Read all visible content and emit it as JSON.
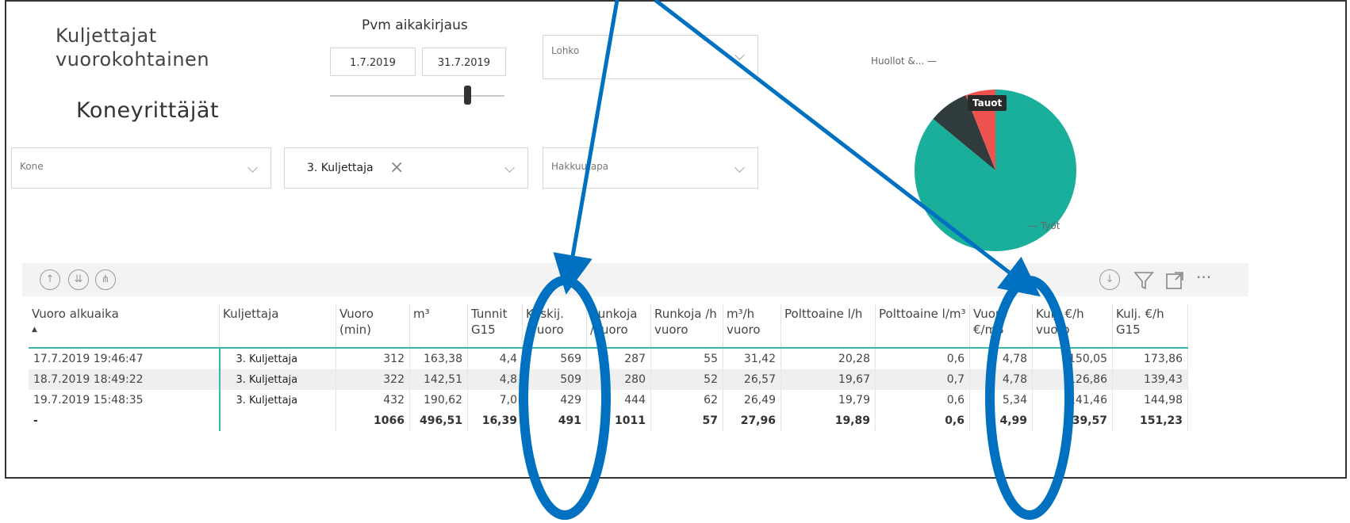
{
  "header": {
    "title_line1": "Kuljettajat",
    "title_line2": "vuorokohtainen",
    "subtitle": "Koneyrittäjät"
  },
  "date_filter": {
    "label": "Pvm aikakirjaus",
    "start": "1.7.2019",
    "end": "31.7.2019",
    "slider_position": 0.78
  },
  "filters": {
    "lohko": "Lohko",
    "kone": "Kone",
    "kuljettaja": "3. Kuljettaja",
    "hakkuutapa": "Hakkuutapa"
  },
  "pie": {
    "slices": [
      {
        "name": "Työt",
        "value": 86,
        "color": "#1aaf9b"
      },
      {
        "name": "Huollot &...",
        "value": 8,
        "color": "#2f3b3d"
      },
      {
        "name": "Tauot",
        "value": 6,
        "color": "#ef5350"
      }
    ],
    "label_huollot": "Huollot &...",
    "label_tyot": "Työt",
    "tooltip": "Tauot"
  },
  "toolbar": {
    "icons": [
      "arrow-up-icon",
      "drill-down-icon",
      "expand-hierarchy-icon"
    ],
    "right_icons": [
      "download-icon",
      "filter-icon",
      "focus-mode-icon",
      "more-options-icon"
    ],
    "more": "···"
  },
  "table": {
    "columns": [
      "Vuoro alkuaika",
      "Kuljettaja",
      "Vuoro (min)",
      "m³",
      "Tunnit G15",
      "Keskij. /vuoro",
      "Runkoja /vuoro",
      "Runkoja /h vuoro",
      "m³/h vuoro",
      "Polttoaine l/h",
      "Polttoaine l/m³",
      "Vuoro €/m3",
      "Kulj. €/h vuoro",
      "Kulj. €/h G15"
    ],
    "rows": [
      [
        "17.7.2019 19:46:47",
        "3. Kuljettaja",
        "312",
        "163,38",
        "4,4",
        "569",
        "287",
        "55",
        "31,42",
        "20,28",
        "0,6",
        "4,78",
        "150,05",
        "173,86"
      ],
      [
        "18.7.2019 18:49:22",
        "3. Kuljettaja",
        "322",
        "142,51",
        "4,8",
        "509",
        "280",
        "52",
        "26,57",
        "19,67",
        "0,7",
        "4,78",
        "126,86",
        "139,43"
      ],
      [
        "19.7.2019 15:48:35",
        "3. Kuljettaja",
        "432",
        "190,62",
        "7,0",
        "429",
        "444",
        "62",
        "26,49",
        "19,79",
        "0,6",
        "5,34",
        "141,46",
        "144,98"
      ]
    ],
    "total": [
      "-",
      "",
      "1066",
      "496,51",
      "16,39",
      "491",
      "1011",
      "57",
      "27,96",
      "19,89",
      "0,6",
      "4,99",
      "139,57",
      "151,23"
    ]
  },
  "annotation": {
    "color": "#0070c0"
  }
}
